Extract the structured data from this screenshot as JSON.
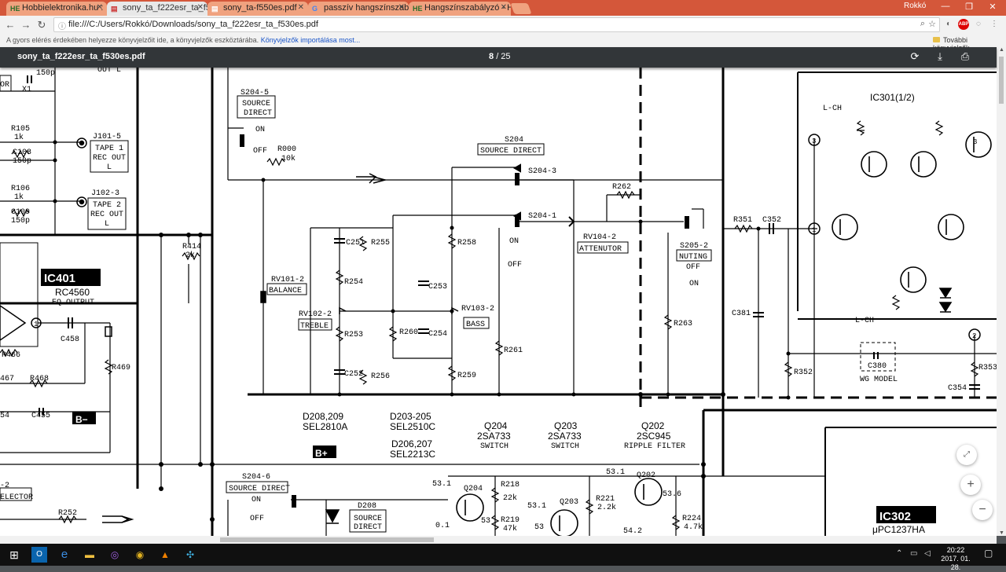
{
  "browser": {
    "tabs": [
      {
        "label": "Hobbielektronika.hu :",
        "favicon": "HE",
        "active": false
      },
      {
        "label": "sony_ta_f222esr_ta_f530e",
        "favicon": "pdf",
        "active": true
      },
      {
        "label": "sony_ta-f550es.pdf",
        "favicon": "pdf",
        "active": false
      },
      {
        "label": "passzív hangszínszabályz",
        "favicon": "G",
        "active": false
      },
      {
        "label": "Hangszínszabályzó - Hob",
        "favicon": "HE",
        "active": false
      }
    ],
    "profile": "Rokkó",
    "address": "file:///C:/Users/Rokkó/Downloads/sony_ta_f222esr_ta_f530es.pdf",
    "bookmark_bar": {
      "message": "A gyors elérés érdekében helyezze könyvjelzőit ide, a könyvjelzők eszköztárába.",
      "link": "Könyvjelzők importálása most...",
      "folder": "További könyvjelzők"
    }
  },
  "pdf": {
    "filename": "sony_ta_f222esr_ta_f530es.pdf",
    "page_current": "8",
    "page_total": "/ 25",
    "zoom_in": "+",
    "zoom_out": "−"
  },
  "schematic": {
    "labels": {
      "s204_5": "S204-5",
      "source_direct_a": "SOURCE",
      "source_direct_b": "DIRECT",
      "on": "ON",
      "off": "OFF",
      "r000": "R000",
      "r000_val": "10k",
      "s204": "S204",
      "s204_box": "SOURCE DIRECT",
      "s204_3": "S204-3",
      "s204_1": "S204-1",
      "r262": "R262",
      "rv104": "RV104-2",
      "attenutor": "ATTENUTOR",
      "s205": "S205-2",
      "nuting": "NUTING",
      "r351": "R351",
      "c352": "C352",
      "ic301": "IC301(1/2)",
      "lch": "L-CH",
      "lch2": "L-CH",
      "c381": "C381",
      "r352": "R352",
      "c380": "C380",
      "wg": "WG MODEL",
      "r353": "R353",
      "c354": "C354",
      "r105": "R105",
      "r105_val": "1k",
      "c108": "C108",
      "c108_val": "150p",
      "r106": "R106",
      "r106_val": "1k",
      "c109": "C109",
      "c109_val": "150p",
      "j101": "J101-5",
      "tape1a": "TAPE 1",
      "tape1b": "REC OUT",
      "tape1c": "L",
      "j102": "J102-3",
      "tape2a": "TAPE 2",
      "tape2b": "REC OUT",
      "tape2c": "L",
      "ic401": "IC401",
      "rc4560": "RC4560",
      "eqout": "EQ OUTPUT",
      "r414": "R414",
      "r414_val": "2k",
      "c458": "C458",
      "r466": "R466",
      "r468": "R468",
      "c455": "C455",
      "r469": "R469",
      "bminus": "B−",
      "bplus": "B+",
      "rv101": "RV101-2",
      "balance": "BALANCE",
      "c251": "C251",
      "r255": "R255",
      "r254": "R254",
      "rv102": "RV102-2",
      "treble": "TREBLE",
      "r253": "R253",
      "c252": "C252",
      "r256": "R256",
      "r258": "R258",
      "c253": "C253",
      "rv103": "RV103-2",
      "bass": "BASS",
      "r260": "R260",
      "c254": "C254",
      "r259": "R259",
      "r261": "R261",
      "r263": "R263",
      "d208_209": "D208,209",
      "sel2810a": "SEL2810A",
      "d203_205": "D203-205",
      "sel2510c": "SEL2510C",
      "d206_207": "D206,207",
      "sel2213c": "SEL2213C",
      "q204": "Q204",
      "q204t": "2SA733",
      "q204f": "SWITCH",
      "q203": "Q203",
      "q203t": "2SA733",
      "q203f": "SWITCH",
      "q202": "Q202",
      "q202t": "2SC945",
      "q202f": "RIPPLE FILTER",
      "s204_6": "S204-6",
      "source_direct_box": "SOURCE DIRECT",
      "d208": "D208",
      "r252": "R252",
      "r218": "R218",
      "r218_val": "22k",
      "r219": "R219",
      "r219_val": "47k",
      "r221": "R221",
      "r221_val": "2.2k",
      "r224": "R224",
      "r224_val": "4.7k",
      "v531": "53.1",
      "v531b": "53.1",
      "v531c": "53.1",
      "v53": "53",
      "v53b": "53",
      "v536": "53.6",
      "v542": "54.2",
      "v01": "0.1",
      "ic302": "IC302",
      "upc": "μPC1237HA",
      "node3": "3",
      "node1": "1",
      "node1b": "1",
      "node2": "2",
      "out_l": "OUT L",
      "c150p_top": "150p",
      "xi": "X1",
      "ectr": "ELECTOR",
      "r254x": "54",
      "r467": "467",
      "cor": "OR",
      "c2": "-2"
    }
  },
  "taskbar": {
    "time": "20:22",
    "date": "2017. 01. 28."
  }
}
